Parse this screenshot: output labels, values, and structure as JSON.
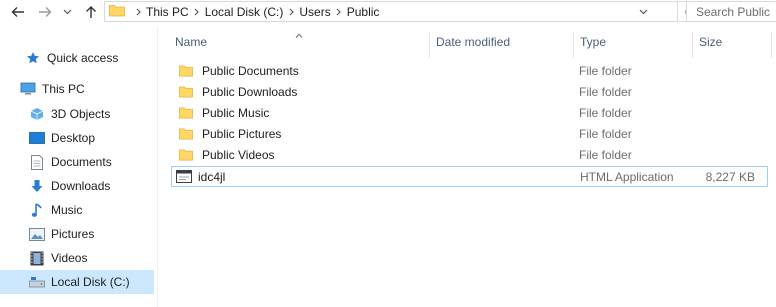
{
  "address_bar": {
    "crumbs": [
      "This PC",
      "Local Disk (C:)",
      "Users",
      "Public"
    ]
  },
  "search": {
    "placeholder": "Search Public"
  },
  "nav_pane": {
    "items": [
      {
        "label": "Quick access",
        "icon": "star-icon"
      },
      {
        "label": "This PC",
        "icon": "computer-icon"
      },
      {
        "label": "3D Objects",
        "icon": "cube-icon"
      },
      {
        "label": "Desktop",
        "icon": "desktop-icon"
      },
      {
        "label": "Documents",
        "icon": "documents-icon"
      },
      {
        "label": "Downloads",
        "icon": "download-arrow-icon"
      },
      {
        "label": "Music",
        "icon": "music-note-icon"
      },
      {
        "label": "Pictures",
        "icon": "pictures-icon"
      },
      {
        "label": "Videos",
        "icon": "film-icon"
      },
      {
        "label": "Local Disk (C:)",
        "icon": "drive-icon",
        "selected": true
      }
    ]
  },
  "columns": {
    "name": "Name",
    "date_modified": "Date modified",
    "type": "Type",
    "size": "Size"
  },
  "files": [
    {
      "name": "Public Documents",
      "date_modified": "",
      "type": "File folder",
      "size": "",
      "icon": "folder-icon"
    },
    {
      "name": "Public Downloads",
      "date_modified": "",
      "type": "File folder",
      "size": "",
      "icon": "folder-icon"
    },
    {
      "name": "Public Music",
      "date_modified": "",
      "type": "File folder",
      "size": "",
      "icon": "folder-icon"
    },
    {
      "name": "Public Pictures",
      "date_modified": "",
      "type": "File folder",
      "size": "",
      "icon": "folder-icon"
    },
    {
      "name": "Public Videos",
      "date_modified": "",
      "type": "File folder",
      "size": "",
      "icon": "folder-icon"
    },
    {
      "name": "idc4jl",
      "date_modified": "",
      "type": "HTML Application",
      "size": "8,227 KB",
      "icon": "hta-window-icon",
      "focused": true
    }
  ],
  "colors": {
    "accent": "#cce8ff",
    "focus_border": "#99d1ff",
    "folder": "#ffd764",
    "header_text": "#4c607a"
  }
}
